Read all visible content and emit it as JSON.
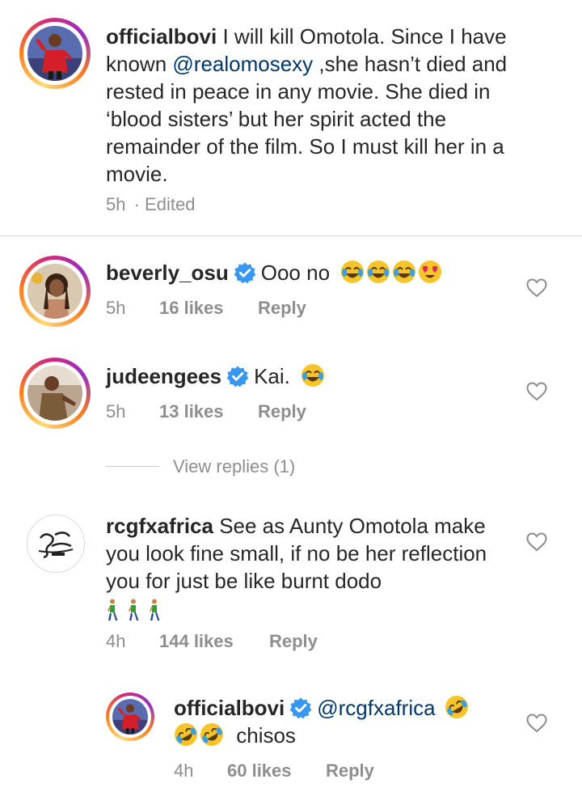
{
  "caption": {
    "username": "officialbovi",
    "text_a": " I will kill Omotola. Since I have known ",
    "mention": "@realomosexy",
    "text_b": " ,she hasn’t died and rested in peace in any movie. She died in ‘blood sisters’ but her spirit acted the remainder of the film. So I must kill her in a movie.",
    "time": "5h",
    "edited": "· Edited"
  },
  "comments": [
    {
      "username": "beverly_osu",
      "text": "Ooo no",
      "emoji": [
        "joy",
        "joy",
        "joy",
        "heart-eyes"
      ],
      "time": "5h",
      "likes": "16 likes",
      "reply": "Reply"
    },
    {
      "username": "judeengees",
      "text": "Kai.",
      "emoji": [
        "joy"
      ],
      "time": "5h",
      "likes": "13 likes",
      "reply": "Reply",
      "view_replies": "View replies (1)"
    },
    {
      "username": "rcgfxafrica",
      "text": " See as Aunty Omotola make you look fine small, if no be her reflection you for just be like burnt dodo",
      "emoji": [
        "person-walking",
        "person-walking",
        "person-walking"
      ],
      "time": "4h",
      "likes": "144 likes",
      "reply": "Reply"
    }
  ],
  "reply": {
    "username": "officialbovi",
    "mention": "@rcgfxafrica",
    "emoji_after_mention": [
      "rofl"
    ],
    "emoji_line2": [
      "rofl",
      "rofl"
    ],
    "text": "chisos",
    "time": "4h",
    "likes": "60 likes",
    "reply": "Reply"
  },
  "colors": {
    "link": "#00376b",
    "muted": "#8e8e8e",
    "verified": "#3897f0",
    "story_ring": [
      "#feda75",
      "#fa7e1e",
      "#d62976",
      "#962fbf"
    ]
  },
  "icons": [
    "heart-outline-icon",
    "verified-badge-icon"
  ]
}
